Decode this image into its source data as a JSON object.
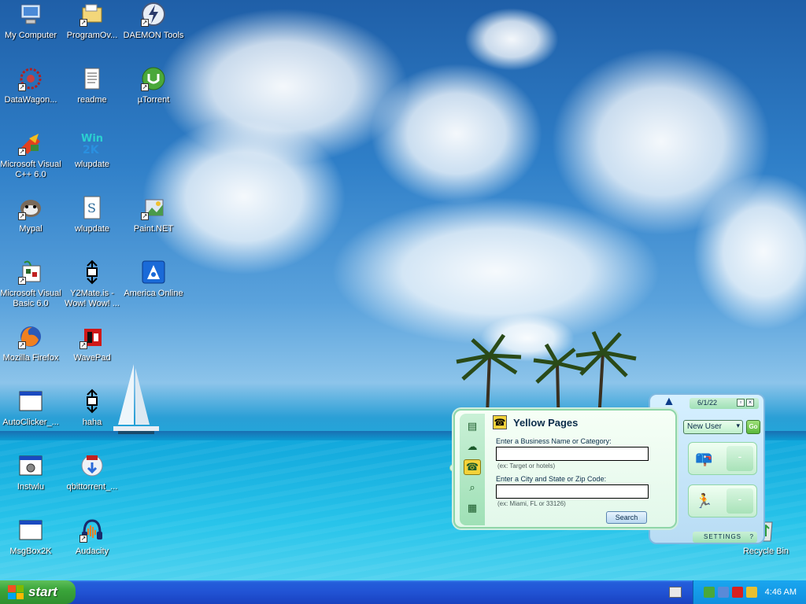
{
  "desktop": {
    "icons": [
      {
        "label": "My Computer",
        "icon": "computer-icon"
      },
      {
        "label": "ProgramOv...",
        "icon": "folder-icon"
      },
      {
        "label": "DAEMON Tools",
        "icon": "daemon-tools-icon"
      },
      {
        "label": "DataWagon...",
        "icon": "datawagon-icon"
      },
      {
        "label": "readme",
        "icon": "text-document-icon"
      },
      {
        "label": "µTorrent",
        "icon": "utorrent-icon"
      },
      {
        "label": "Microsoft Visual C++ 6.0",
        "icon": "visual-cpp-icon"
      },
      {
        "label": "wlupdate",
        "icon": "win2000-icon"
      },
      {
        "label": "Mypal",
        "icon": "mypal-icon"
      },
      {
        "label": "wlupdate",
        "icon": "script-document-icon"
      },
      {
        "label": "Paint.NET",
        "icon": "paint-net-icon"
      },
      {
        "label": "Microsoft Visual Basic 6.0",
        "icon": "visual-basic-icon"
      },
      {
        "label": "Y2Mate.is - Wow! Wow! ...",
        "icon": "move-icon"
      },
      {
        "label": "America Online",
        "icon": "aol-icon"
      },
      {
        "label": "Mozilla Firefox",
        "icon": "firefox-icon"
      },
      {
        "label": "WavePad",
        "icon": "wavepad-icon"
      },
      {
        "label": "AutoClicker_...",
        "icon": "window-icon"
      },
      {
        "label": "haha",
        "icon": "move-icon"
      },
      {
        "label": "Instwlu",
        "icon": "installer-icon"
      },
      {
        "label": "qbittorrent_...",
        "icon": "qbittorrent-icon"
      },
      {
        "label": "MsgBox2K",
        "icon": "window-icon"
      },
      {
        "label": "Audacity",
        "icon": "audacity-icon"
      },
      {
        "label": "Recycle Bin",
        "icon": "recycle-bin-icon"
      }
    ]
  },
  "yellow_pages": {
    "title": "Yellow Pages",
    "business_label": "Enter a Business Name or Category:",
    "business_value": "",
    "business_hint": "(ex: Target or hotels)",
    "location_label": "Enter a City and State or Zip Code:",
    "location_value": "",
    "location_hint": "(ex: Miami, FL or 33126)",
    "search_button": "Search"
  },
  "aim": {
    "date": "6/1/22",
    "user_select": "New User",
    "go_button": "Go",
    "settings": "SETTINGS"
  },
  "taskbar": {
    "start_label": "start",
    "clock": "4:46 AM"
  }
}
